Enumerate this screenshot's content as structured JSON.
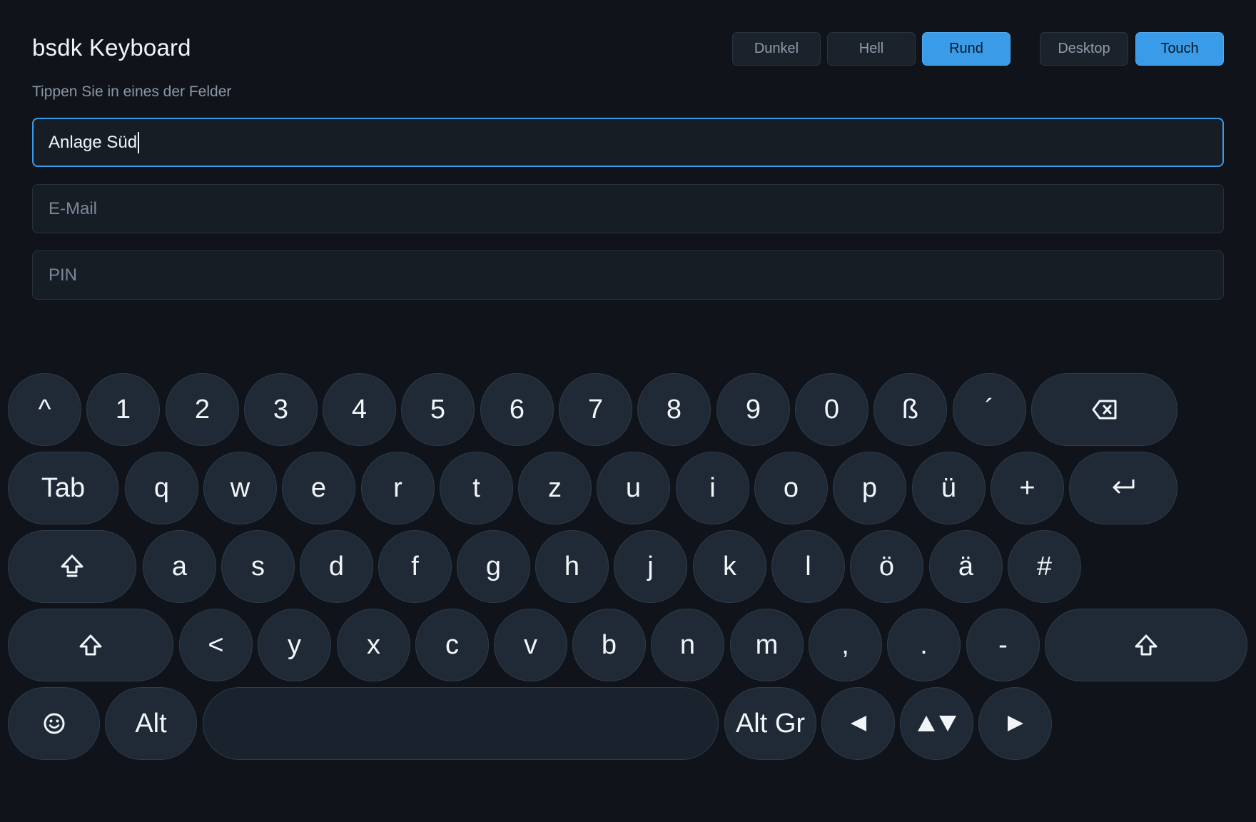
{
  "header": {
    "title": "bsdk Keyboard",
    "subtitle": "Tippen Sie in eines der Felder"
  },
  "theme_buttons": [
    "Dunkel",
    "Hell",
    "Rund"
  ],
  "active_theme": "Rund",
  "mode_buttons": [
    "Desktop",
    "Touch"
  ],
  "active_mode": "Touch",
  "fields": {
    "name_value": "Anlage Süd",
    "email_placeholder": "E-Mail",
    "pin_placeholder": "PIN"
  },
  "keyboard": {
    "row1": [
      "^",
      "1",
      "2",
      "3",
      "4",
      "5",
      "6",
      "7",
      "8",
      "9",
      "0",
      "ß",
      "´"
    ],
    "row2": [
      "Tab",
      "q",
      "w",
      "e",
      "r",
      "t",
      "z",
      "u",
      "i",
      "o",
      "p",
      "ü",
      "+"
    ],
    "row3": [
      "a",
      "s",
      "d",
      "f",
      "g",
      "h",
      "j",
      "k",
      "l",
      "ö",
      "ä",
      "#"
    ],
    "row4": [
      "<",
      "y",
      "x",
      "c",
      "v",
      "b",
      "n",
      "m",
      ",",
      ".",
      "-"
    ],
    "alt_label": "Alt",
    "altgr_label": "Alt Gr",
    "icons": {
      "backspace": "backspace-icon",
      "enter": "enter-icon",
      "caps": "caps-lock-icon",
      "shift": "shift-icon",
      "emoji": "emoji-icon",
      "left": "arrow-left-icon",
      "updown": "arrow-up-down-icon",
      "right": "arrow-right-icon"
    }
  },
  "colors": {
    "background": "#10141a",
    "accent": "#3a9be8",
    "key": "#1f2a36"
  }
}
